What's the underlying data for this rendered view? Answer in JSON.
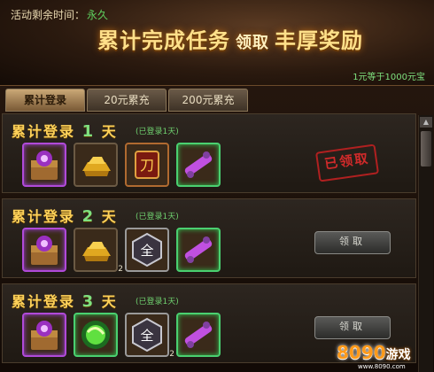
{
  "banner": {
    "timer_label": "活动剩余时间：",
    "timer_value": "永久",
    "title_left": "累计完成任务",
    "title_mid": "领取",
    "title_right": "丰厚奖励",
    "rate": "1元等于1000元宝"
  },
  "tabs": [
    {
      "label": "累计登录"
    },
    {
      "label": "20元累充"
    },
    {
      "label": "200元累充"
    }
  ],
  "rows": [
    {
      "title_a": "累计登录",
      "n": "1",
      "title_b": "天",
      "sub": "(已登录1天)",
      "status": "已领取",
      "items": [
        {
          "icon": "treasure-chest-icon",
          "qty": ""
        },
        {
          "icon": "gold-ingot-icon",
          "qty": ""
        },
        {
          "icon": "blade-scroll-icon",
          "qty": ""
        },
        {
          "icon": "purple-scroll-icon",
          "qty": ""
        }
      ]
    },
    {
      "title_a": "累计登录",
      "n": "2",
      "title_b": "天",
      "sub": "(已登录1天)",
      "button": "领取",
      "items": [
        {
          "icon": "treasure-chest-icon",
          "qty": ""
        },
        {
          "icon": "gold-ingot-icon",
          "qty": "2"
        },
        {
          "icon": "quan-token-icon",
          "qty": ""
        },
        {
          "icon": "purple-scroll-icon",
          "qty": ""
        }
      ]
    },
    {
      "title_a": "累计登录",
      "n": "3",
      "title_b": "天",
      "sub": "(已登录1天)",
      "button": "领取",
      "items": [
        {
          "icon": "treasure-chest-icon",
          "qty": ""
        },
        {
          "icon": "green-orb-icon",
          "qty": ""
        },
        {
          "icon": "quan-token-icon",
          "qty": "2"
        },
        {
          "icon": "purple-scroll-icon",
          "qty": ""
        }
      ]
    }
  ],
  "watermark": {
    "brand": "8090",
    "suffix": "游戏",
    "url": "www.8090.com"
  },
  "colors": {
    "accent_gold": "#ffd25a",
    "day_green": "#7fe07f",
    "claimed_red": "#d02a2a"
  }
}
